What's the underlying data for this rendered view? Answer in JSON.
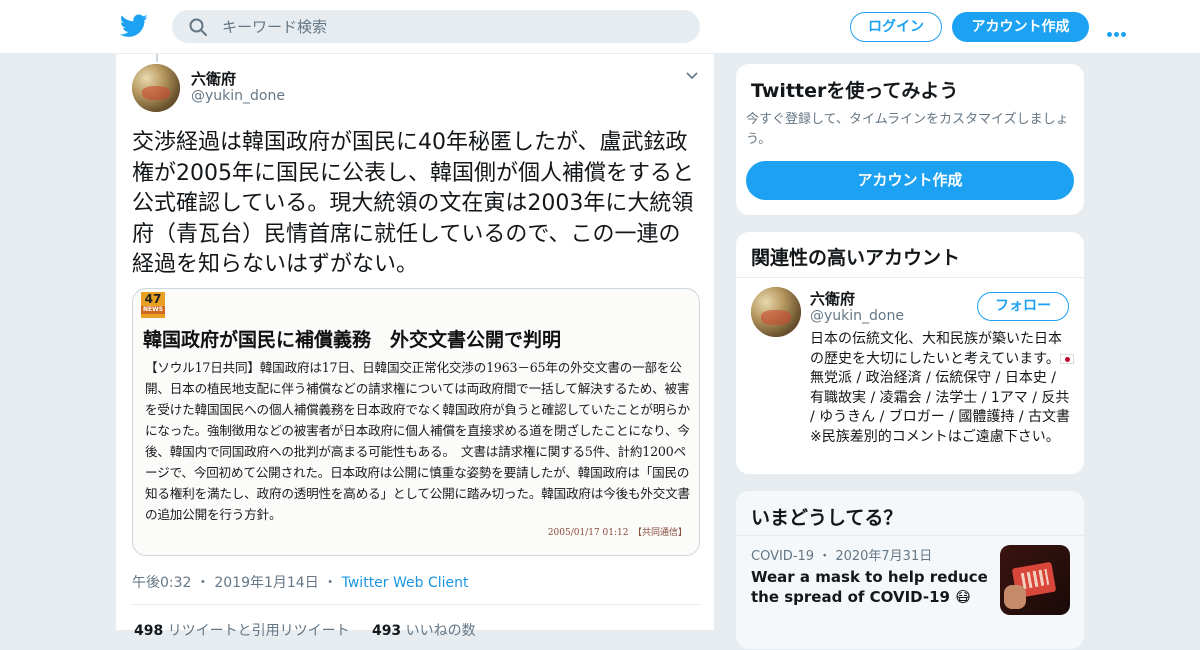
{
  "header": {
    "search_placeholder": "キーワード検索",
    "login_label": "ログイン",
    "signup_label": "アカウント作成"
  },
  "tweet": {
    "author_name": "六衛府",
    "author_handle": "@yukin_done",
    "text": "交渉経過は韓国政府が国民に40年秘匿したが、盧武鉉政権が2005年に国民に公表し、韓国側が個人補償をすると公式確認している。現大統領の文在寅は2003年に大統領府（青瓦台）民情首席に就任しているので、この一連の経過を知らないはずがない。",
    "media": {
      "logo_text": "47",
      "logo_sub": "NEWS",
      "headline": "韓国政府が国民に補償義務　外交文書公開で判明",
      "body": "【ソウル17日共同】韓国政府は17日、日韓国交正常化交渉の1963－65年の外交文書の一部を公開、日本の植民地支配に伴う補償などの請求権については両政府間で一括して解決するため、被害を受けた韓国国民への個人補償義務を日本政府でなく韓国政府が負うと確認していたことが明らかになった。強制徴用などの被害者が日本政府に個人補償を直接求める道を閉ざしたことになり、今後、韓国内で同国政府への批判が高まる可能性もある。　文書は請求権に関する5件、計約1200ページで、今回初めて公開された。日本政府は公開に慎重な姿勢を要請したが、韓国政府は「国民の知る権利を満たし、政府の透明性を高める」として公開に踏み切った。韓国政府は今後も外交文書の追加公開を行う方針。",
      "footer": "2005/01/17 01:12　【共同通信】"
    },
    "time": "午後0:32",
    "date": "2019年1月14日",
    "client": "Twitter Web Client",
    "retweet_count": "498",
    "retweet_label": "リツイートと引用リツイート",
    "like_count": "493",
    "like_label": "いいねの数"
  },
  "signup_card": {
    "title": "Twitterを使ってみよう",
    "subtitle": "今すぐ登録して、タイムラインをカスタマイズしましょう。",
    "button_label": "アカウント作成"
  },
  "related_card": {
    "title": "関連性の高いアカウント",
    "name": "六衛府",
    "handle": "@yukin_done",
    "follow_label": "フォロー",
    "bio_before_flag": "日本の伝統文化、大和民族が築いた日本の歴史を大切にしたいと考えています。",
    "bio_after_flag": " 無党派 / 政治経済 / 伝統保守 / 日本史 / 有職故実 / 凌霜会 / 法学士 / 1アマ / 反共 / ゆうきん / ブロガー / 國體護持 / 古文書 ※民族差別的コメントはご遠慮下さい。"
  },
  "trends_card": {
    "title": "いまどうしてる？",
    "trend_category": "COVID-19",
    "trend_date": "2020年7月31日",
    "trend_title": "Wear a mask to help reduce the spread of COVID-19 😷"
  },
  "colors": {
    "accent": "#1da1f2",
    "background": "#e6ecf0"
  }
}
